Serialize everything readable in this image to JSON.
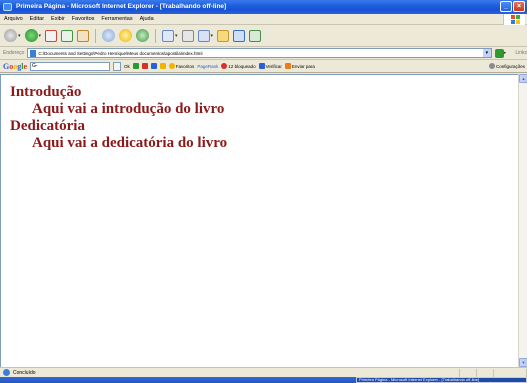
{
  "window": {
    "title": "Primeira Página - Microsoft Internet Explorer - [Trabalhando off-line]"
  },
  "menu": [
    "Arquivo",
    "Editar",
    "Exibir",
    "Favoritos",
    "Ferramentas",
    "Ajuda"
  ],
  "address_bar": {
    "label": "Endereço",
    "value": "C:\\Documents and Settings\\Pedro Henrique\\Meus documentos\\apostila\\index.html",
    "links_label": "Links"
  },
  "google_toolbar": {
    "logo": "Google",
    "search_value": "G-",
    "search_button": "Ok",
    "favorites": "Favoritos",
    "pagerank": "PageRank",
    "blocked": "12 bloqueado",
    "verify": "Verificar",
    "send_to": "Enviar para",
    "settings": "Configurações"
  },
  "content": {
    "items": [
      {
        "heading": "Introdução",
        "body": "Aqui vai a introdução do livro"
      },
      {
        "heading": "Dedicatória",
        "body": "Aqui vai a dedicatória do livro"
      }
    ]
  },
  "status": {
    "text": "Concluído"
  },
  "taskbar": {
    "active_item": "Primeira Página - Microsoft Internet Explorer - [Trabalhando off-line]"
  },
  "colors": {
    "content_text": "#8b1a1a",
    "titlebar": "#1f5ee0"
  }
}
